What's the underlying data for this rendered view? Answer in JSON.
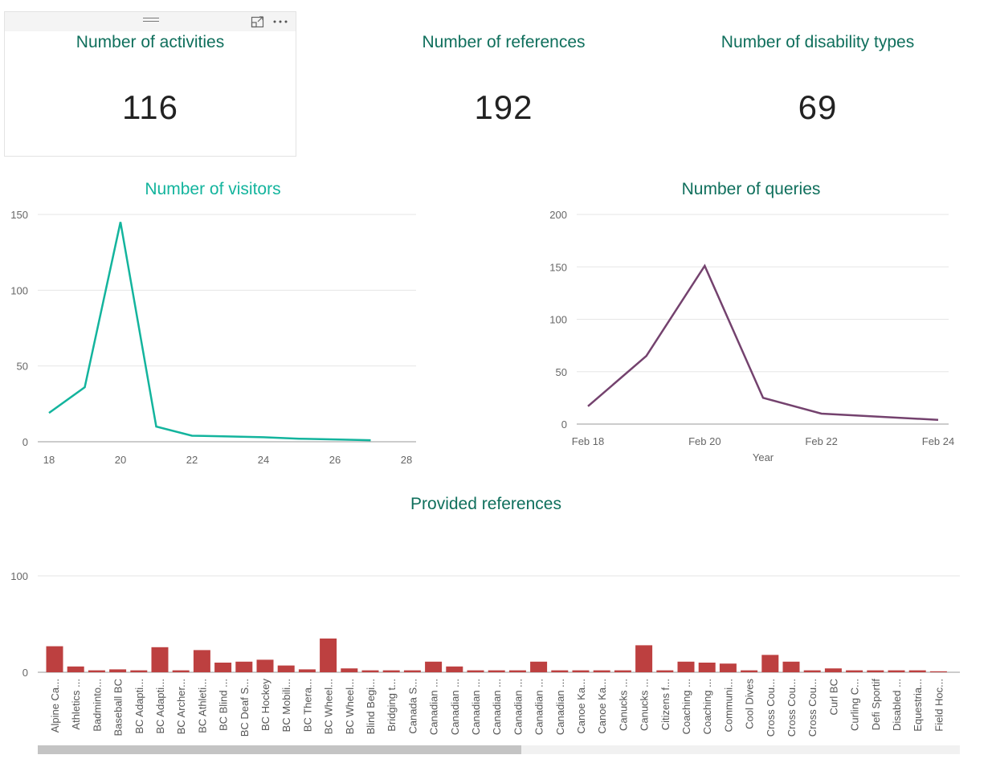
{
  "colors": {
    "title_teal": "#0f6f5c",
    "visitors_line": "#13b49d",
    "queries_line": "#74426e",
    "bar_fill": "#bd4040"
  },
  "kpis": [
    {
      "title": "Number of activities",
      "value": "116"
    },
    {
      "title": "Number of references",
      "value": "192"
    },
    {
      "title": "Number of disability types",
      "value": "69"
    }
  ],
  "card_header": {
    "focus_icon": "focus-mode-icon",
    "more_icon": "more-options-icon"
  },
  "visitors": {
    "title": "Number of visitors"
  },
  "queries": {
    "title": "Number of queries",
    "xlabel": "Year"
  },
  "references": {
    "title": "Provided references"
  },
  "chart_data": [
    {
      "type": "line",
      "title": "Number of visitors",
      "x": [
        18,
        19,
        20,
        21,
        22,
        23,
        24,
        25,
        26,
        27
      ],
      "values": [
        19,
        36,
        145,
        10,
        4,
        3.5,
        3,
        2,
        1.5,
        1
      ],
      "xlim": [
        18,
        28
      ],
      "ylim": [
        0,
        150
      ],
      "xticks": [
        "18",
        "20",
        "22",
        "24",
        "26",
        "28"
      ],
      "yticks": [
        "0",
        "50",
        "100",
        "150"
      ],
      "grid": true
    },
    {
      "type": "line",
      "title": "Number of queries",
      "x": [
        "Feb 18",
        "Feb 19",
        "Feb 20",
        "Feb 21",
        "Feb 22",
        "Feb 23",
        "Feb 24"
      ],
      "values": [
        17,
        65,
        151,
        25,
        10,
        7,
        4
      ],
      "xlabel": "Year",
      "ylim": [
        0,
        200
      ],
      "xticks": [
        "Feb 18",
        "Feb 20",
        "Feb 22",
        "Feb 24"
      ],
      "yticks": [
        "0",
        "50",
        "100",
        "150",
        "200"
      ],
      "grid": true
    },
    {
      "type": "bar",
      "title": "Provided references",
      "categories": [
        "Alpine Ca...",
        "Athletics ...",
        "Badminto...",
        "Baseball BC",
        "BC Adapti...",
        "BC Adapti...",
        "BC Archer...",
        "BC Athleti...",
        "BC Blind ...",
        "BC Deaf S...",
        "BC Hockey",
        "BC Mobili...",
        "BC Thera...",
        "BC Wheel...",
        "BC Wheel...",
        "Blind Begi...",
        "Bridging t...",
        "Canada S...",
        "Canadian ...",
        "Canadian ...",
        "Canadian ...",
        "Canadian ...",
        "Canadian ...",
        "Canadian ...",
        "Canadian ...",
        "Canoe Ka...",
        "Canoe Ka...",
        "Canucks ...",
        "Canucks ...",
        "Citizens f...",
        "Coaching ...",
        "Coaching ...",
        "Communi...",
        "Cool Dives",
        "Cross Cou...",
        "Cross Cou...",
        "Cross Cou...",
        "Curl BC",
        "Curling C...",
        "Defi Sportif",
        "Disabled ...",
        "Equestria...",
        "Field Hoc..."
      ],
      "values": [
        27,
        6,
        2,
        3,
        2,
        26,
        2,
        23,
        10,
        11,
        13,
        7,
        3,
        35,
        4,
        2,
        2,
        2,
        11,
        6,
        2,
        2,
        2,
        11,
        2,
        2,
        2,
        2,
        28,
        2,
        11,
        10,
        9,
        2,
        18,
        11,
        2,
        4,
        2,
        2,
        2,
        2,
        1
      ],
      "ylim": [
        0,
        100
      ],
      "yticks": [
        "0",
        "100"
      ],
      "grid": true
    }
  ]
}
